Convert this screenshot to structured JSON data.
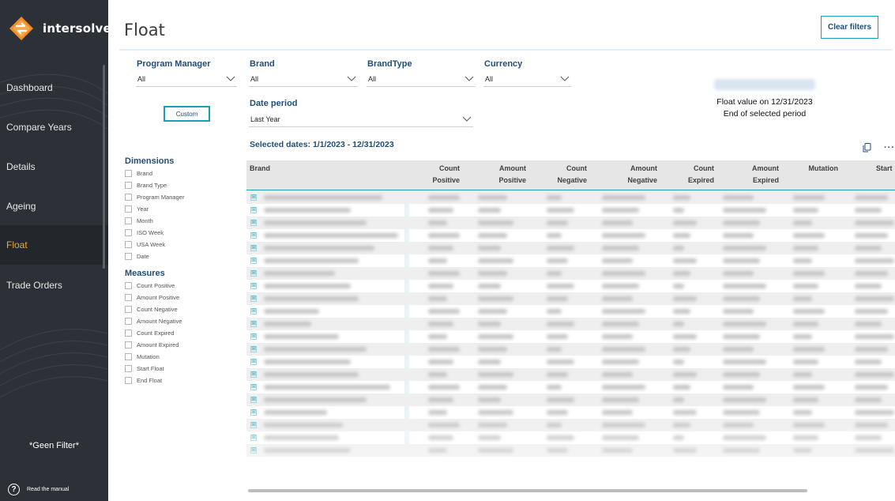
{
  "sidebar": {
    "logo_text": "intersolve",
    "items": [
      {
        "label": "Dashboard"
      },
      {
        "label": "Compare Years"
      },
      {
        "label": "Details"
      },
      {
        "label": "Ageing"
      },
      {
        "label": "Float",
        "active": true
      },
      {
        "label": "Trade Orders"
      }
    ],
    "filter_text": "*Geen Filter*",
    "manual_label": "Read the manual"
  },
  "page": {
    "title": "Float",
    "clear_filters": "Clear filters"
  },
  "slicers": {
    "program_manager": {
      "label": "Program Manager",
      "value": "All"
    },
    "brand": {
      "label": "Brand",
      "value": "All"
    },
    "brand_type": {
      "label": "BrandType",
      "value": "All"
    },
    "currency": {
      "label": "Currency",
      "value": "All"
    },
    "date_period": {
      "label": "Date period",
      "value": "Last Year"
    },
    "custom_button": "Custom"
  },
  "kpi": {
    "line1": "Float value on 12/31/2023",
    "line2": "End of selected period"
  },
  "selected_dates": "Selected dates: 1/1/2023 - 12/31/2023",
  "dimensions": {
    "title": "Dimensions",
    "items": [
      "Brand",
      "Brand Type",
      "Program Manager",
      "Year",
      "Month",
      "ISO Week",
      "USA Week",
      "Date"
    ]
  },
  "measures": {
    "title": "Measures",
    "items": [
      "Count Positive",
      "Amount Positive",
      "Count Negative",
      "Amount Negative",
      "Count Expired",
      "Amount Expired",
      "Mutation",
      "Start Float",
      "End Float"
    ]
  },
  "table": {
    "headers": [
      {
        "l1": "Brand",
        "l2": ""
      },
      {
        "l1": "Count",
        "l2": "Positive"
      },
      {
        "l1": "Amount",
        "l2": "Positive"
      },
      {
        "l1": "Count",
        "l2": "Negative"
      },
      {
        "l1": "Amount",
        "l2": "Negative"
      },
      {
        "l1": "Count",
        "l2": "Expired"
      },
      {
        "l1": "Amount",
        "l2": "Expired"
      },
      {
        "l1": "Mutation",
        "l2": ""
      },
      {
        "l1": "Start",
        "l2": ""
      }
    ],
    "expand_glyph": "⊞"
  },
  "colors": {
    "sidebar_bg": "#2b3136",
    "active_nav": "#f2a43a",
    "accent": "#16a0b8",
    "label_blue": "#1f4e79",
    "logo_orange": "#f28c28"
  }
}
